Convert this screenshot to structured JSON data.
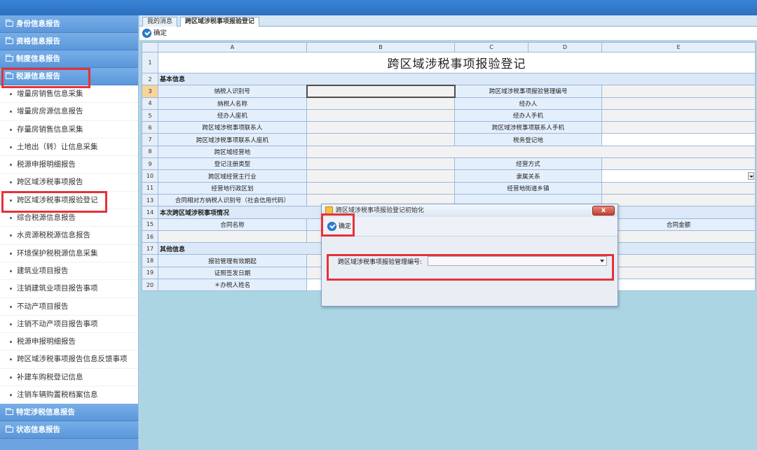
{
  "sidebar": {
    "top_sections": [
      "身份信息报告",
      "资格信息报告",
      "制度信息报告",
      "税源信息报告"
    ],
    "items": [
      "增量房销售信息采集",
      "增量房房源信息报告",
      "存量房销售信息采集",
      "土地出（转）让信息采集",
      "税源申报明细报告",
      "跨区域涉税事项报告",
      "跨区域涉税事项报验登记",
      "综合税源信息报告",
      "水资源税税源信息报告",
      "环境保护税税源信息采集",
      "建筑业项目报告",
      "注销建筑业项目报告事项",
      "不动产项目报告",
      "注销不动产项目报告事项",
      "税源申报明细报告",
      "跨区域涉税事项报告信息反馈事项",
      "补建车购税登记信息",
      "注销车辆购置税档案信息"
    ],
    "bottom_sections": [
      "特定涉税信息报告",
      "状态信息报告"
    ]
  },
  "tabs": [
    "我的消息",
    "跨区域涉税事项报验登记"
  ],
  "toolbar": {
    "ok_label": "确定"
  },
  "sheet": {
    "columns": [
      "A",
      "B",
      "C",
      "D",
      "E"
    ],
    "title": "跨区域涉税事项报验登记",
    "sections": {
      "basic": "基本信息",
      "current": "本次跨区域涉税事项情况",
      "other": "其他信息"
    },
    "rows": {
      "r3": [
        "纳税人识别号",
        "跨区域涉税事项报验管理编号"
      ],
      "r4": [
        "纳税人名称",
        "经办人"
      ],
      "r5": [
        "经办人座机",
        "经办人手机"
      ],
      "r6": [
        "跨区域涉税事项联系人",
        "跨区域涉税事项联系人手机"
      ],
      "r7": [
        "跨区域涉税事项联系人座机",
        "税务登记地"
      ],
      "r8": [
        "跨区域经营地"
      ],
      "r9": [
        "登记注册类型",
        "经营方式"
      ],
      "r10": [
        "跨区域经营主行业",
        "隶属关系"
      ],
      "r11": [
        "经营地行政区划",
        "经营地街道乡镇"
      ],
      "r13": [
        "合同相对方纳税人识别号（社会信用代码）"
      ],
      "r15": [
        "合同名称",
        "合同金额"
      ],
      "r18": [
        "报验管理有效期起"
      ],
      "r19": [
        "证照签发日期"
      ],
      "r20": [
        "＊办税人姓名"
      ]
    }
  },
  "dialog": {
    "title": "跨区域涉税事项报验登记初始化",
    "close": "x",
    "ok_label": "确定",
    "field_label": "跨区域涉税事项报验管理编号:",
    "field_value": ""
  },
  "colors": {
    "highlight": "#e53238",
    "sidebar_header": "#5b97d9",
    "main_bg": "#acd5e3"
  }
}
